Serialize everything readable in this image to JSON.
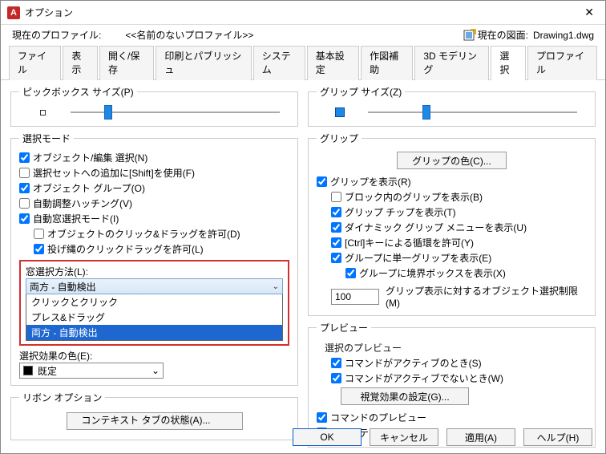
{
  "window": {
    "title": "オプション"
  },
  "header": {
    "profile_label": "現在のプロファイル:",
    "profile_name": "<<名前のないプロファイル>>",
    "drawing_label": "現在の図面:",
    "drawing_name": "Drawing1.dwg"
  },
  "tabs": [
    "ファイル",
    "表示",
    "開く/保存",
    "印刷とパブリッシュ",
    "システム",
    "基本設定",
    "作図補助",
    "3D モデリング",
    "選択",
    "プロファイル"
  ],
  "tabs_active_index": 8,
  "left": {
    "pickbox_group": "ピックボックス サイズ(P)",
    "selmode_group": "選択モード",
    "selmode": {
      "obj_edit": "オブジェクト/編集 選択(N)",
      "shift_add": "選択セットへの追加に[Shift]を使用(F)",
      "obj_group": "オブジェクト グループ(O)",
      "auto_hatch": "自動調整ハッチング(V)",
      "auto_window": "自動窓選択モード(I)",
      "click_drag": "オブジェクトのクリック&ドラッグを許可(D)",
      "lasso_drag": "投げ縄のクリックドラッグを許可(L)"
    },
    "window_method_label": "窓選択方法(L):",
    "window_method_value": "両方 - 自動検出",
    "window_method_options": [
      "クリックとクリック",
      "プレス&ドラッグ",
      "両方 - 自動検出"
    ],
    "effect_color_label": "選択効果の色(E):",
    "effect_color_value": "既定",
    "ribbon_group": "リボン オプション",
    "ribbon_btn": "コンテキスト タブの状態(A)..."
  },
  "right": {
    "gripsize_group": "グリップ サイズ(Z)",
    "grip_group": "グリップ",
    "grip_color_btn": "グリップの色(C)...",
    "grip": {
      "show_grip": "グリップを表示(R)",
      "in_block": "ブロック内のグリップを表示(B)",
      "tip": "グリップ チップを表示(T)",
      "dyn_menu": "ダイナミック グリップ メニューを表示(U)",
      "ctrl_cycle": "[Ctrl]キーによる循環を許可(Y)",
      "single_group": "グループに単一グリップを表示(E)",
      "group_bbox": "グループに境界ボックスを表示(X)",
      "limit_label": "グリップ表示に対するオブジェクト選択制限(M)",
      "limit_value": "100"
    },
    "preview_group": "プレビュー",
    "preview_sub": "選択のプレビュー",
    "preview": {
      "cmd_active": "コマンドがアクティブのとき(S)",
      "cmd_inactive": "コマンドがアクティブでないとき(W)",
      "visual_btn": "視覚効果の設定(G)...",
      "cmd_preview": "コマンドのプレビュー",
      "prop_preview": "プロパティのプレビュー"
    }
  },
  "footer": {
    "ok": "OK",
    "cancel": "キャンセル",
    "apply": "適用(A)",
    "help": "ヘルプ(H)"
  }
}
